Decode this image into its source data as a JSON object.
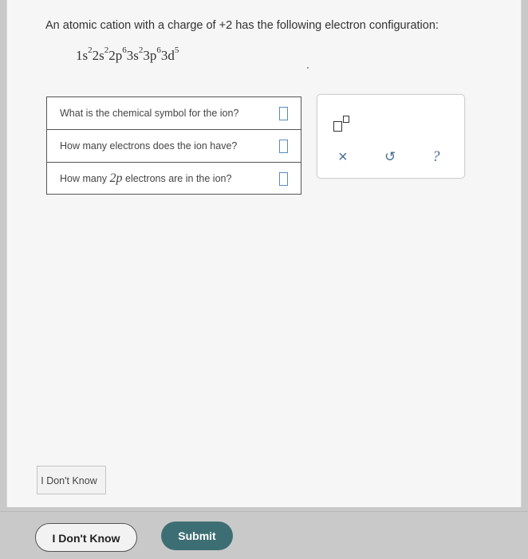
{
  "question": {
    "prefix": "An atomic cation with a charge of ",
    "charge": "+2",
    "suffix": " has the following electron configuration:"
  },
  "configuration": [
    {
      "orbital": "1s",
      "electrons": "2"
    },
    {
      "orbital": "2s",
      "electrons": "2"
    },
    {
      "orbital": "2p",
      "electrons": "6"
    },
    {
      "orbital": "3s",
      "electrons": "2"
    },
    {
      "orbital": "3p",
      "electrons": "6"
    },
    {
      "orbital": "3d",
      "electrons": "5"
    }
  ],
  "rows": [
    {
      "label": "What is the chemical symbol for the ion?",
      "answer": ""
    },
    {
      "label_pre": "How many electrons does the ion have?",
      "answer": ""
    },
    {
      "label_pre": "How many ",
      "label_em": "2p",
      "label_post": " electrons are in the ion?",
      "answer": ""
    }
  ],
  "toolbar": {
    "superscript_icon": "superscript-box-icon",
    "clear_icon": "×",
    "undo_icon": "↺",
    "help_icon": "?"
  },
  "dont_know_inline": "I Don't Know",
  "footer": {
    "dont_know": "I Don't Know",
    "submit": "Submit"
  },
  "colors": {
    "submit_bg": "#3d6e74",
    "answer_box_border": "#5a8bc0",
    "tool_icon": "#4a6e96"
  }
}
